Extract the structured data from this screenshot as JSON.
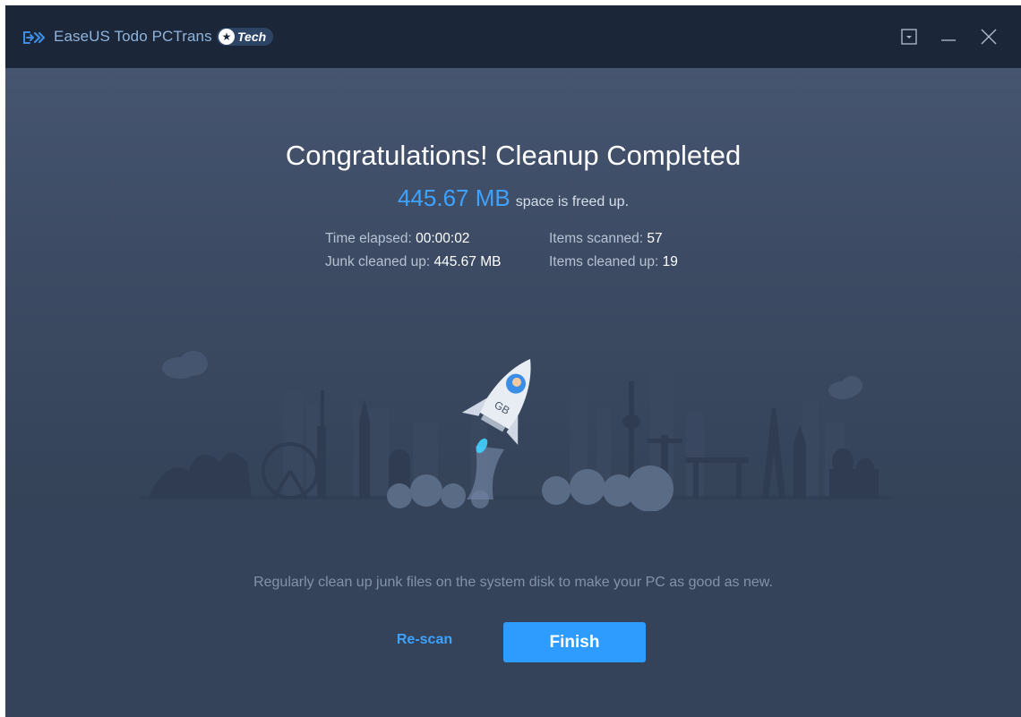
{
  "window": {
    "app_name": "EaseUS Todo PCTrans",
    "badge": "Tech",
    "menu_icon": "dropdown-menu-icon",
    "minimize_icon": "minimize-icon",
    "close_icon": "close-icon"
  },
  "result": {
    "headline": "Congratulations! Cleanup Completed",
    "freed_amount": "445.67 MB",
    "freed_suffix": "space is freed up.",
    "stats_left": [
      {
        "label": "Time elapsed:",
        "value": "00:00:02"
      },
      {
        "label": "Junk cleaned up:",
        "value": "445.67 MB"
      }
    ],
    "stats_right": [
      {
        "label": "Items scanned:",
        "value": "57"
      },
      {
        "label": "Items cleaned up:",
        "value": "19"
      }
    ]
  },
  "illustration": {
    "rocket_label": "GB",
    "icon": "rocket-launch-illustration"
  },
  "footer": {
    "tip": "Regularly clean up junk files on the system disk to make your PC as good as new.",
    "rescan_label": "Re-scan",
    "finish_label": "Finish"
  },
  "colors": {
    "accent": "#2e9bff",
    "accent_text": "#3ea2ff",
    "titlebar": "#1b2638",
    "background": "#344256"
  }
}
